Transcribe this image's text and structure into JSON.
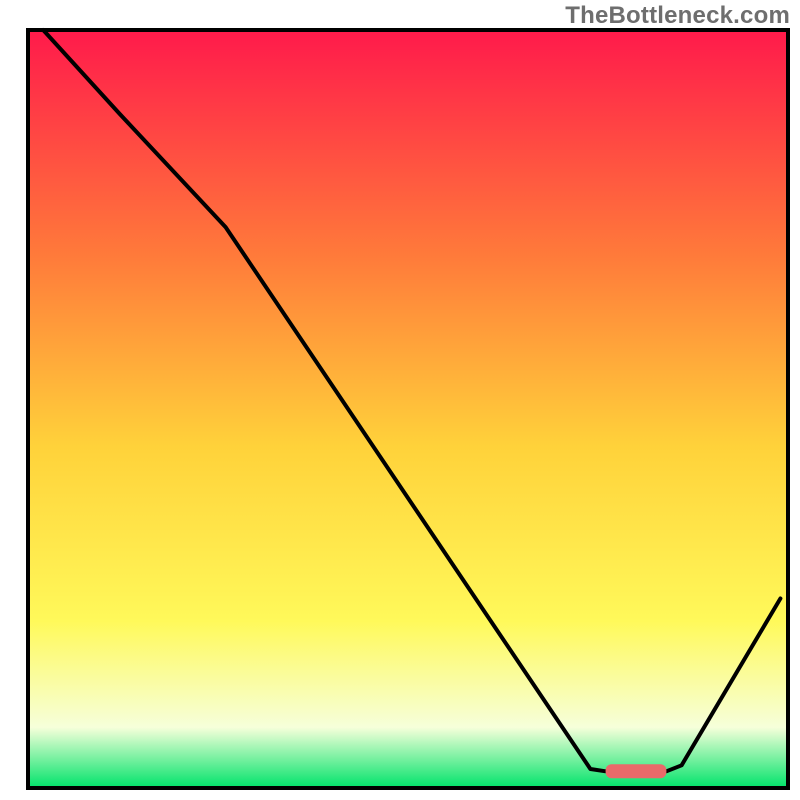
{
  "watermark": "TheBottleneck.com",
  "colors": {
    "frame": "#000000",
    "curve": "#000000",
    "marker_fill": "#e96a6a",
    "grad_top": "#ff1a4b",
    "grad_mid1": "#ff7b3a",
    "grad_mid2": "#ffd23a",
    "grad_mid3": "#fff95a",
    "grad_pale": "#f6ffda",
    "grad_green": "#00e36a"
  },
  "chart_data": {
    "type": "line",
    "title": "",
    "xlabel": "",
    "ylabel": "",
    "xlim": [
      0,
      100
    ],
    "ylim": [
      0,
      100
    ],
    "x": [
      2,
      12,
      26,
      74,
      76,
      84,
      86,
      99
    ],
    "values": [
      100,
      89,
      74,
      2.5,
      2.2,
      2.2,
      3,
      25
    ],
    "marker": {
      "x_start": 76,
      "x_end": 84,
      "y": 2.2
    },
    "annotations": []
  }
}
